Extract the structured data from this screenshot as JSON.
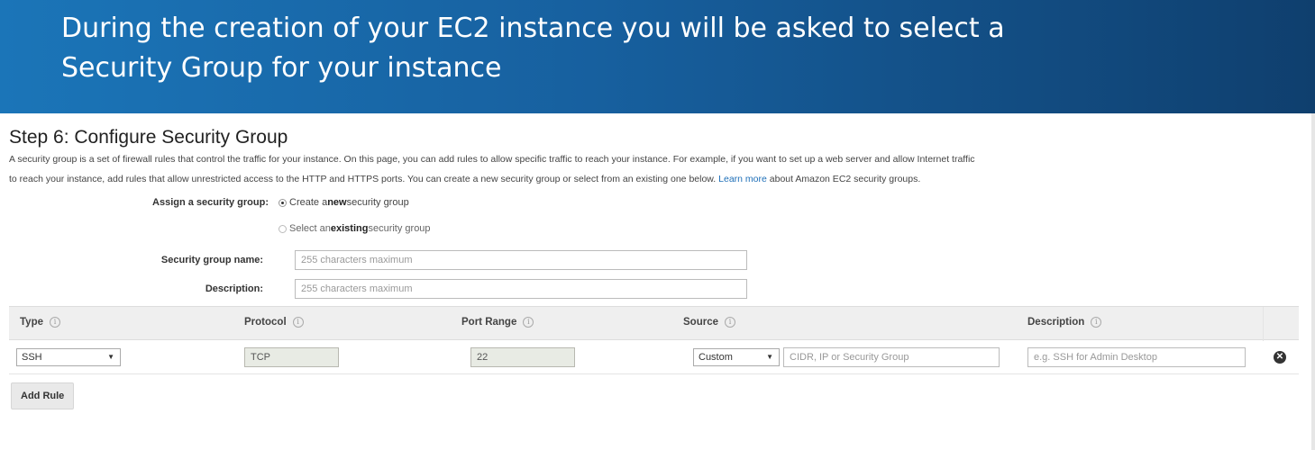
{
  "banner": {
    "line1": "During the creation of your EC2 instance you will be asked to select a",
    "line2": "Security Group for your instance"
  },
  "page": {
    "title": "Step 6: Configure Security Group",
    "intro_line1": "A security group is a set of firewall rules that control the traffic for your instance. On this page, you can add rules to allow specific traffic to reach your instance. For example, if you want to set up a web server and allow Internet traffic",
    "intro_line2_pre": "to reach your instance, add rules that allow unrestricted access to the HTTP and HTTPS ports. You can create a new security group or select from an existing one below. ",
    "intro_link": "Learn more",
    "intro_line2_post": " about Amazon EC2 security groups."
  },
  "form": {
    "assign_label": "Assign a security group:",
    "radio_create_pre": "Create a ",
    "radio_create_bold": "new",
    "radio_create_post": " security group",
    "radio_existing_pre": "Select an ",
    "radio_existing_bold": "existing",
    "radio_existing_post": " security group",
    "name_label": "Security group name:",
    "name_placeholder": "255 characters maximum",
    "description_label": "Description:",
    "description_placeholder": "255 characters maximum"
  },
  "table": {
    "headers": {
      "type": "Type",
      "protocol": "Protocol",
      "port_range": "Port Range",
      "source": "Source",
      "description": "Description"
    },
    "info_glyph": "i",
    "rows": [
      {
        "type": "SSH",
        "protocol": "TCP",
        "port_range": "22",
        "source": "Custom",
        "source_placeholder": "CIDR, IP or Security Group",
        "description_placeholder": "e.g. SSH for Admin Desktop"
      }
    ]
  },
  "actions": {
    "add_rule": "Add Rule",
    "remove_glyph": "✕"
  },
  "colors": {
    "banner_start": "#1b75b8",
    "banner_end": "#0f3f6e",
    "link": "#1e6fb8",
    "readonly_bg": "#e8ebe4"
  },
  "icons": {
    "info": "info-icon",
    "dropdown": "chevron-down-icon",
    "remove": "remove-circle-icon"
  }
}
